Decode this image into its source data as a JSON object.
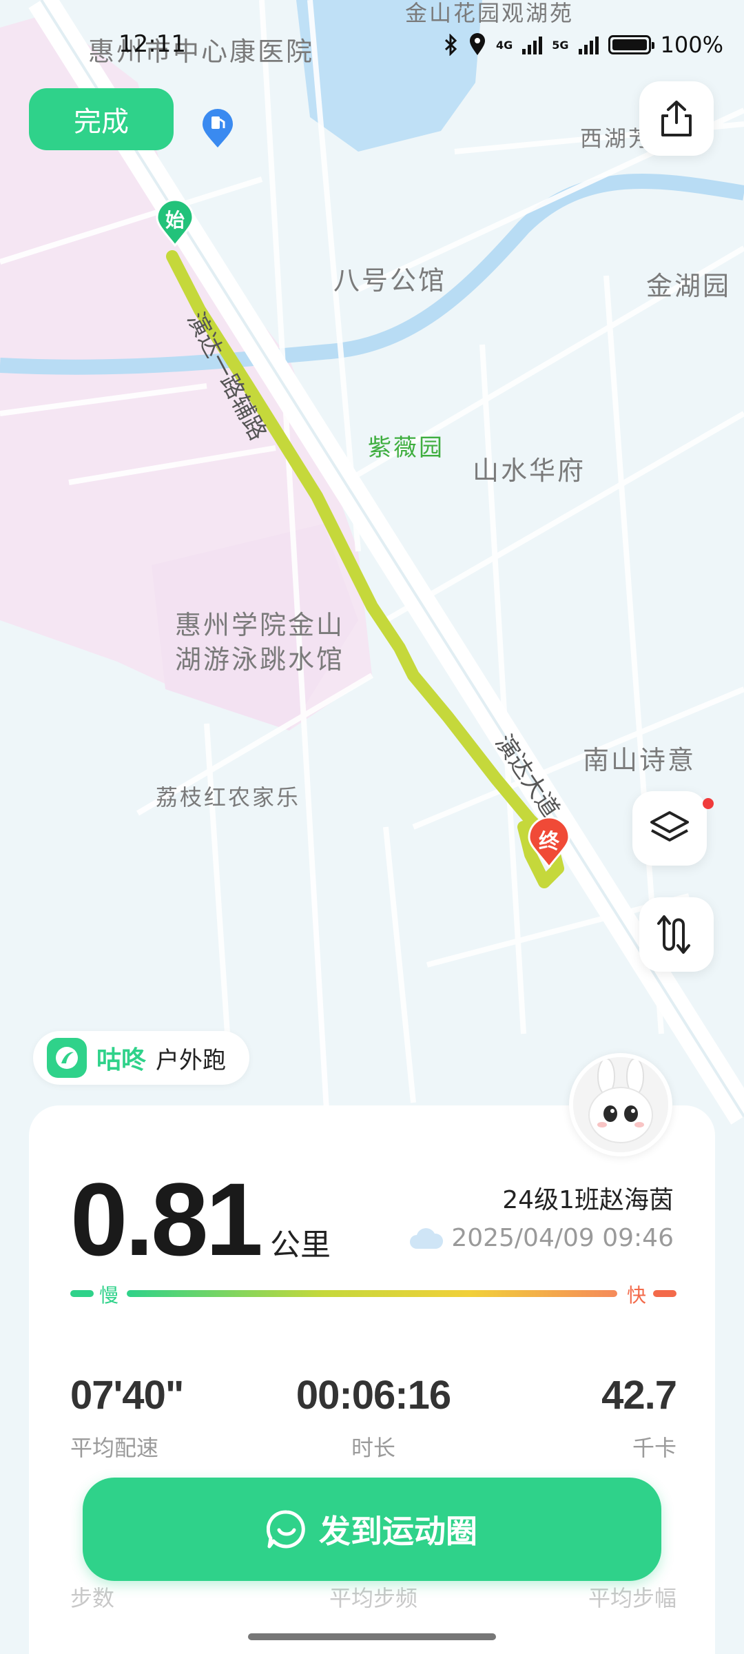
{
  "status_bar": {
    "time": "12:11",
    "battery": "100%",
    "net1": "4G",
    "net2": "5G"
  },
  "top": {
    "done_label": "完成",
    "share_icon": "share-icon"
  },
  "map": {
    "places": {
      "hospital": "惠州市中心康医院",
      "lake": "金山花园观湖苑",
      "xihu": "西湖芳",
      "bahao": "八号公馆",
      "jinhu": "金湖园",
      "ziwei": "紫薇园",
      "shanshui": "山水华府",
      "college": "惠州学院金山",
      "college2": "湖游泳跳水馆",
      "nanshan": "南山诗意",
      "lizhi": "荔枝红农家乐",
      "road_yanda": "演达大道",
      "road_yanda_side": "演达一路辅路"
    },
    "start_label": "始",
    "end_label": "终",
    "colors": {
      "route": "#c5d83b",
      "start": "#22c27a",
      "end": "#f04a37"
    }
  },
  "controls": {
    "layers_icon": "layers-icon",
    "route_icon": "route-icon"
  },
  "app": {
    "name": "咕咚",
    "mode": "户外跑",
    "accent": "#2fd28a"
  },
  "summary": {
    "distance": "0.81",
    "distance_unit": "公里",
    "user": "24级1班赵海茵",
    "datetime": "2025/04/09 09:46",
    "pace_slow": "慢",
    "pace_fast": "快",
    "stats": [
      {
        "value": "07'40\"",
        "label": "平均配速"
      },
      {
        "value": "00:06:16",
        "label": "时长"
      },
      {
        "value": "42.7",
        "label": "千卡"
      }
    ],
    "stats2": [
      "步数",
      "平均步频",
      "平均步幅"
    ]
  },
  "share_button": {
    "label": "发到运动圈"
  }
}
